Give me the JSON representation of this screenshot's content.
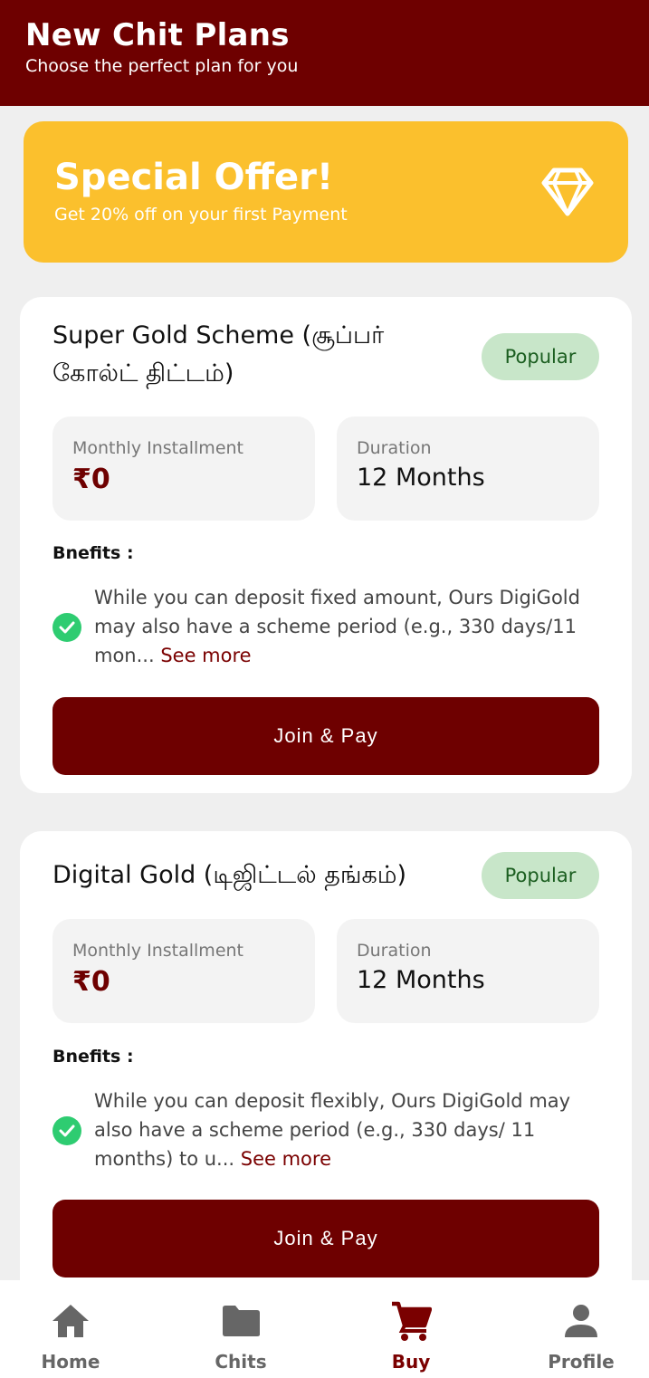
{
  "header": {
    "title": "New Chit Plans",
    "subtitle": "Choose the perfect plan for you"
  },
  "offer": {
    "title": "Special Offer!",
    "subtitle": "Get 20% off on your first Payment",
    "icon": "diamond-icon"
  },
  "plans": [
    {
      "name": "Super Gold Scheme (சூப்பர் கோல்ட் திட்டம்)",
      "badge": "Popular",
      "installment_label": "Monthly Installment",
      "installment_value": "₹0",
      "duration_label": "Duration",
      "duration_value": "12 Months",
      "benefits_label": "Bnefits :",
      "benefit_text": "While you can deposit fixed amount, Ours DigiGold may also have a scheme period (e.g., 330 days/11 mon...",
      "see_more": "See more",
      "button": "Join & Pay"
    },
    {
      "name": "Digital Gold (டிஜிட்டல் தங்கம்)",
      "badge": "Popular",
      "installment_label": "Monthly Installment",
      "installment_value": "₹0",
      "duration_label": "Duration",
      "duration_value": "12 Months",
      "benefits_label": "Bnefits :",
      "benefit_text": "While you can deposit flexibly, Ours DigiGold may also have a scheme period (e.g., 330 days/ 11 months) to u...",
      "see_more": "See more",
      "button": "Join & Pay"
    }
  ],
  "nav": {
    "items": [
      {
        "label": "Home",
        "icon": "home-icon"
      },
      {
        "label": "Chits",
        "icon": "folder-icon"
      },
      {
        "label": "Buy",
        "icon": "cart-icon",
        "active": true
      },
      {
        "label": "Profile",
        "icon": "person-icon"
      }
    ]
  },
  "colors": {
    "primary": "#6e0000",
    "offer_bg": "#fbc02d",
    "badge_bg": "#c8e6c9",
    "badge_text": "#1b5e20",
    "check": "#2ecc71"
  }
}
